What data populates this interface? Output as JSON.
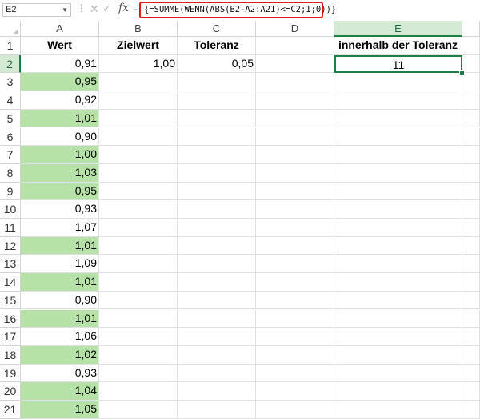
{
  "formula_bar": {
    "cell_ref": "E2",
    "formula": "{=SUMME(WENN(ABS(B2-A2:A21)<=C2;1;0))}",
    "fx_label": "fx"
  },
  "colors": {
    "highlight": "#b6e2a8",
    "active_border": "#1e7e45",
    "formula_outline": "#e01b1b"
  },
  "columns": [
    "A",
    "B",
    "C",
    "D",
    "E"
  ],
  "rows": [
    "1",
    "2",
    "3",
    "4",
    "5",
    "6",
    "7",
    "8",
    "9",
    "10",
    "11",
    "12",
    "13",
    "14",
    "15",
    "16",
    "17",
    "18",
    "19",
    "20",
    "21"
  ],
  "headers": {
    "a": "Wert",
    "b": "Zielwert",
    "c": "Toleranz",
    "e": "innerhalb der Toleranz"
  },
  "row2": {
    "b": "1,00",
    "c": "0,05",
    "e": "11"
  },
  "values": [
    "0,91",
    "0,95",
    "0,92",
    "1,01",
    "0,90",
    "1,00",
    "1,03",
    "0,95",
    "0,93",
    "1,07",
    "1,01",
    "1,09",
    "1,01",
    "0,90",
    "1,01",
    "1,06",
    "1,02",
    "0,93",
    "1,04",
    "1,05"
  ],
  "highlighted": [
    false,
    true,
    false,
    true,
    false,
    true,
    true,
    true,
    false,
    false,
    true,
    false,
    true,
    false,
    true,
    false,
    true,
    false,
    true,
    true
  ]
}
